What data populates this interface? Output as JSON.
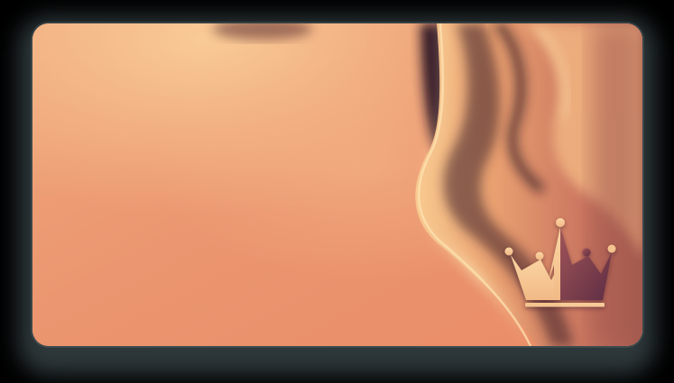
{
  "card": {
    "background": "abstract-gradient-waves",
    "colors": {
      "base": "#e9906a",
      "light": "#f6c18e",
      "highlight": "#fbd9a6",
      "dark": "#2a1524",
      "mid": "#b76556",
      "frame": "#53666c"
    }
  },
  "logo": {
    "icon": "crown-icon",
    "colors": {
      "left": "#f6c896",
      "right": "#7e3f4d"
    }
  }
}
